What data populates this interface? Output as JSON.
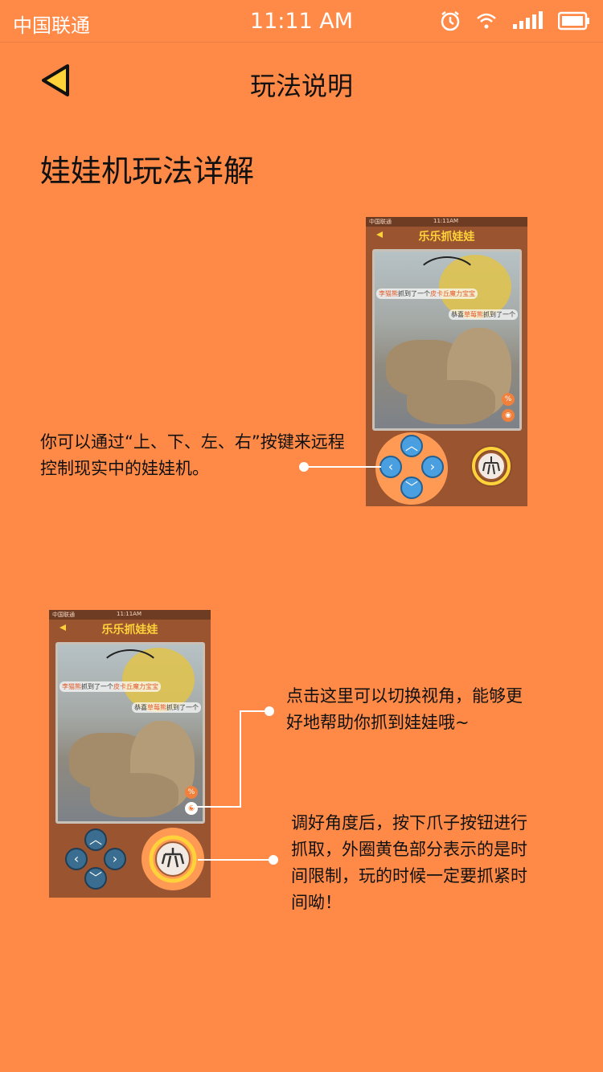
{
  "status_bar": {
    "carrier": "中国联通",
    "time": "11:11 AM"
  },
  "header": {
    "title": "玩法说明"
  },
  "section": {
    "title": "娃娃机玩法详解"
  },
  "mockup": {
    "carrier": "中国联通",
    "time": "11:11AM",
    "app_title": "乐乐抓娃娃",
    "msg1_name": "李猫熊",
    "msg1_mid": "抓到了一个",
    "msg1_prize": "皮卡丘魔力宝宝",
    "msg2_prefix": "恭喜",
    "msg2_name": "草莓熊",
    "msg2_mid": "抓到了一个"
  },
  "callouts": {
    "controls": "你可以通过“上、下、左、右”按键来远程控制现实中的娃娃机。",
    "camera_line1": "点击这里可以切换视角，能够更",
    "camera_line2": "好地帮助你抓到娃娃哦~",
    "claw_line1": "调好角度后，按下爪子按钮进行",
    "claw_line2": "抓取，外圈黄色部分表示的是时",
    "claw_line3": "间限制，玩的时候一定要抓紧时",
    "claw_line4": "间呦！"
  },
  "colors": {
    "background": "#FF8A47",
    "mock_bg": "#9A5430",
    "accent_yellow": "#FFD23A",
    "dpad_blue": "#4A9FE0"
  }
}
